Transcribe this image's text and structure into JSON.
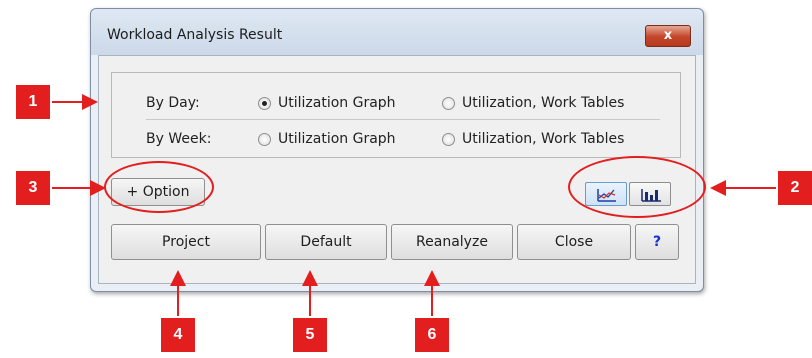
{
  "dialog": {
    "title": "Workload Analysis Result",
    "close_glyph": "x"
  },
  "options": {
    "by_day_label": "By Day:",
    "by_week_label": "By Week:",
    "by_day": [
      {
        "label": "Utilization Graph",
        "selected": true
      },
      {
        "label": "Utilization, Work Tables",
        "selected": false
      }
    ],
    "by_week": [
      {
        "label": "Utilization Graph",
        "selected": false
      },
      {
        "label": "Utilization, Work Tables",
        "selected": false
      }
    ]
  },
  "toolbar": {
    "option_label": "+ Option",
    "view_buttons": [
      {
        "icon": "line-chart-icon",
        "pressed": true
      },
      {
        "icon": "bar-chart-icon",
        "pressed": false
      }
    ]
  },
  "footer": {
    "project_label": "Project",
    "default_label": "Default",
    "reanalyze_label": "Reanalyze",
    "close_label": "Close",
    "help_label": "?"
  },
  "callouts": [
    "1",
    "2",
    "3",
    "4",
    "5",
    "6"
  ],
  "colors": {
    "callout": "#e31e1e",
    "help_glyph": "#1a2fcf"
  }
}
